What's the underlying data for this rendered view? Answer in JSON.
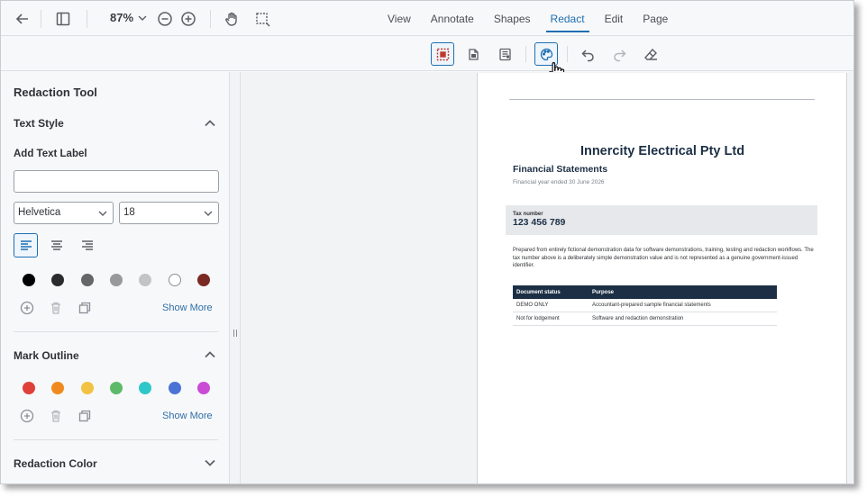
{
  "topbar": {
    "zoom": "87%",
    "tabs": [
      {
        "label": "View",
        "active": false
      },
      {
        "label": "Annotate",
        "active": false
      },
      {
        "label": "Shapes",
        "active": false
      },
      {
        "label": "Redact",
        "active": true
      },
      {
        "label": "Edit",
        "active": false
      },
      {
        "label": "Page",
        "active": false
      }
    ]
  },
  "panel": {
    "title": "Redaction Tool",
    "text_style": {
      "heading": "Text Style",
      "add_text_label": "Add Text Label",
      "text_value": "",
      "font": "Helvetica",
      "size": "18",
      "colors": [
        "#000000",
        "#2b2b2b",
        "#666666",
        "#999999",
        "#c4c4c4",
        "#ffffff",
        "#7a2a22"
      ],
      "show_more": "Show More"
    },
    "mark_outline": {
      "heading": "Mark Outline",
      "colors": [
        "#e0403a",
        "#f08a1e",
        "#f2c243",
        "#5cba6a",
        "#2ec7c9",
        "#4a73d4",
        "#c94bd6"
      ],
      "show_more": "Show More"
    },
    "redaction_color": {
      "heading": "Redaction Color"
    }
  },
  "document": {
    "company": "Innercity Electrical Pty Ltd",
    "subtitle": "Financial Statements",
    "date": "Financial year ended 30 June 2026",
    "tax_label": "Tax number",
    "tax_number": "123 456 789",
    "paragraph": "Prepared from entirely fictional demonstration data for software demonstrations, training, testing and redaction workflows. The tax number above is a deliberately simple demonstration value and is not represented as a genuine government-issued identifier.",
    "table": {
      "headers": [
        "Document status",
        "Purpose"
      ],
      "rows": [
        [
          "DEMO ONLY",
          "Accountant-prepared sample financial statements"
        ],
        [
          "Not for lodgement",
          "Software and redaction demonstration"
        ]
      ]
    }
  }
}
